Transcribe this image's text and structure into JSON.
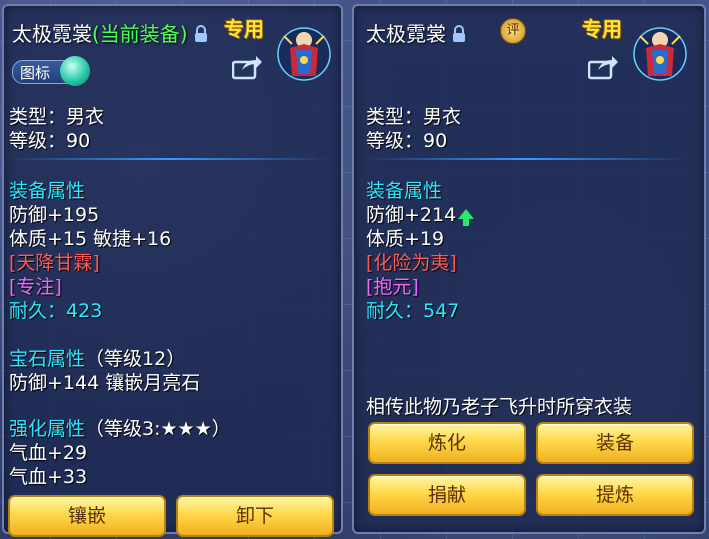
{
  "current": {
    "name": "太极霓裳",
    "equipped_tag": "(当前装备)",
    "exclusive": "专用",
    "toggle_label": "图标",
    "type": "类型：男衣",
    "level": "等级：90",
    "equip_attr_title": "装备属性",
    "defense": "防御+195",
    "stats": "体质+15 敏捷+16",
    "special_effect": "[天降甘霖]",
    "special_skill": "[专注]",
    "durability_label": "耐久：",
    "durability_value": "423",
    "gem_title": "宝石属性",
    "gem_level": "（等级12）",
    "gem_line": "防御+144 镶嵌月亮石",
    "enhance_title": "强化属性",
    "enhance_level": "（等级3:★★★）",
    "enhance_line1": "气血+29",
    "enhance_line2": "气血+33",
    "buttons": {
      "inlay": "镶嵌",
      "unequip": "卸下"
    }
  },
  "compare": {
    "name": "太极霓裳",
    "review_badge": "评",
    "exclusive": "专用",
    "type": "类型：男衣",
    "level": "等级：90",
    "equip_attr_title": "装备属性",
    "defense": "防御+214",
    "stats": "体质+19",
    "special_effect": "[化险为夷]",
    "special_skill": "[抱元]",
    "durability_label": "耐久：",
    "durability_value": "547",
    "description": "相传此物乃老子飞升时所穿衣装",
    "buttons": {
      "refine": "炼化",
      "equip": "装备",
      "donate": "捐献",
      "extract": "提炼"
    }
  },
  "colors": {
    "section": "#2ee6ff",
    "special_effect": "#ff5a5a",
    "special_skill": "#ee6aff",
    "equipped": "#4dff52",
    "exclusive": "#ffe23a",
    "button": "#ffd84a"
  },
  "icons": [
    "lock-icon",
    "share-icon",
    "review-badge",
    "item-armor-icon",
    "upgrade-arrow-icon"
  ]
}
